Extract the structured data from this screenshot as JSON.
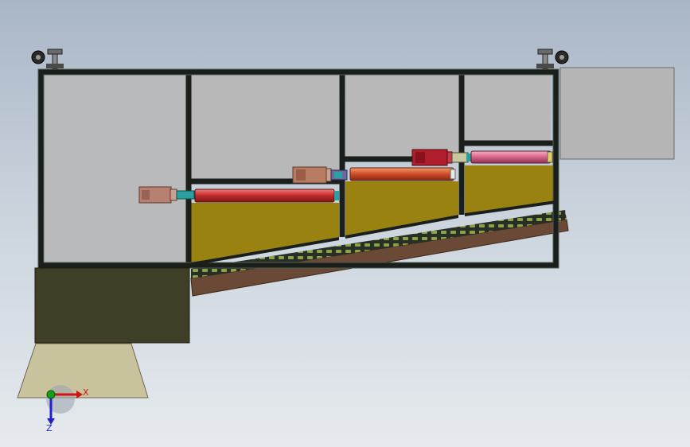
{
  "viewport": {
    "background_top": "#a9b6c6",
    "background_bottom": "#e6eaee"
  },
  "colors": {
    "frame": "#1b1f1b",
    "frame_edge": "#3a4a3a",
    "panel_gray": "#b7b7b7",
    "hopper_fill": "#9a8210",
    "conveyor_belt": "#6a4a36",
    "conveyor_rollers": "#8aa24a",
    "base_block": "#3f3f28",
    "base_skirt": "#c8c39c",
    "roller_red": "#c83232",
    "roller_orange": "#d24a2a",
    "roller_pink": "#d86a8a",
    "motor_tan": "#b88070",
    "motor_red": "#b01e2e",
    "coupling_teal": "#2aa0a0",
    "axis_x": "#d01414",
    "axis_y": "#14a014",
    "axis_z": "#2222cc"
  },
  "icons": {
    "caster_left": "caster-wheel-icon",
    "caster_right": "caster-wheel-icon",
    "triad": "coordinate-triad-icon"
  },
  "triad": {
    "x_label": "X",
    "z_label": "Z"
  }
}
